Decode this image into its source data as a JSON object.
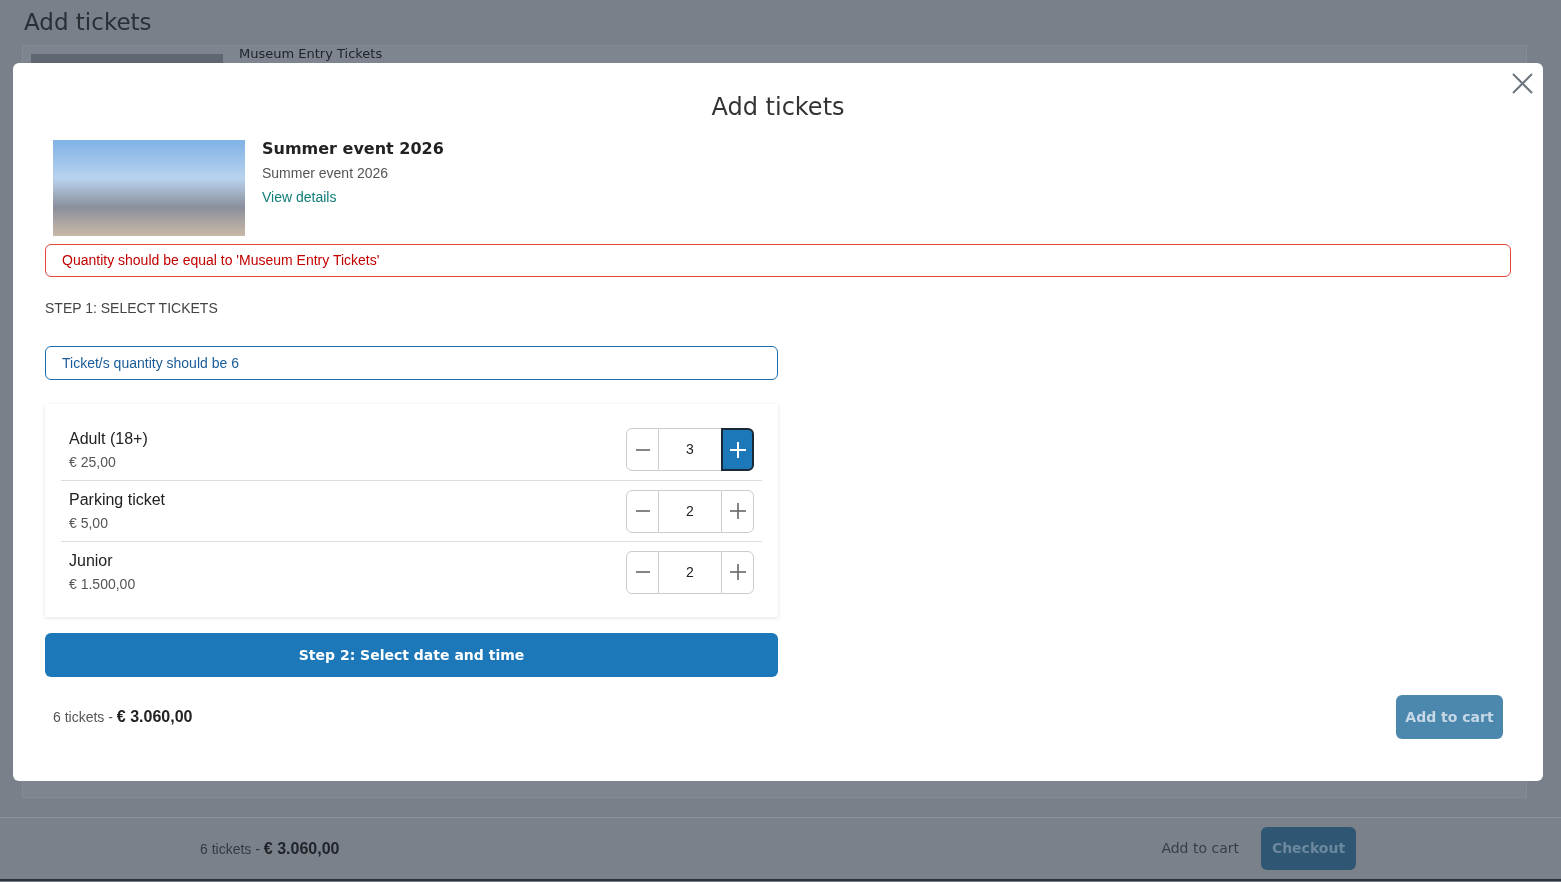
{
  "background_page": {
    "title": "Add tickets",
    "item": {
      "title": "Museum Entry Tickets"
    },
    "footer": {
      "summary": "6 tickets - **€ 3.060,00**",
      "add_to_cart": "Add to cart",
      "checkout": "Checkout"
    }
  },
  "modal": {
    "title": "Add tickets",
    "event": {
      "title": "Summer event 2026",
      "subtitle": "Summer event 2026",
      "link": "View details"
    },
    "error": "Quantity should be equal to 'Museum Entry Tickets'",
    "step_label": "STEP 1: SELECT TICKETS",
    "info": "Ticket/s quantity should be 6",
    "tickets": [
      {
        "name": "Adult (18+)",
        "price": "€ 25,00",
        "quantity": "3",
        "plus_highlighted": true
      },
      {
        "name": "Parking ticket",
        "price": "€ 5,00",
        "quantity": "2",
        "plus_highlighted": false
      },
      {
        "name": "Junior",
        "price": "€ 1.500,00",
        "quantity": "2",
        "plus_highlighted": false
      }
    ],
    "next_button": "Step 2: Select date and time",
    "summary": "6 tickets - **€ 3.060,00**",
    "add_to_cart": {
      "label": "Add to cart",
      "disabled": true
    }
  }
}
